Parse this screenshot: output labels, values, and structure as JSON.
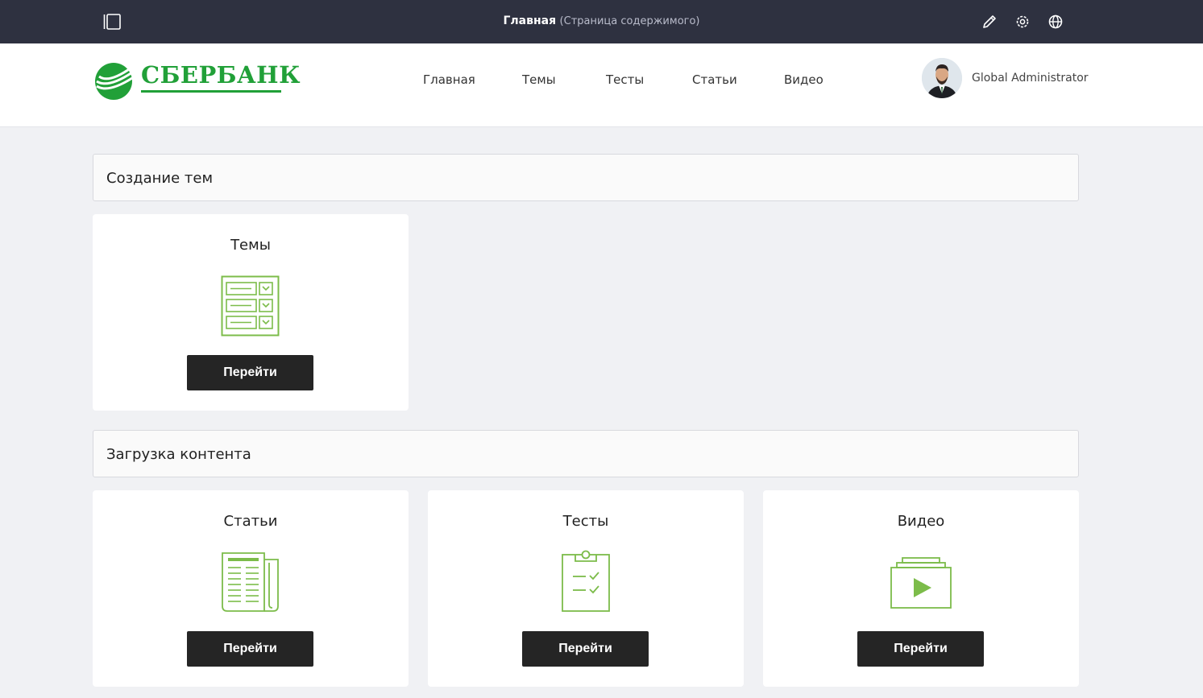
{
  "adminbar": {
    "title": "Главная",
    "subtitle": "(Страница содержимого)",
    "icons": [
      "sidebar-toggle-icon",
      "pencil-icon",
      "gear-icon",
      "globe-icon"
    ]
  },
  "header": {
    "logo_text": "СБЕРБАНК",
    "nav": [
      {
        "label": "Главная"
      },
      {
        "label": "Темы"
      },
      {
        "label": "Тесты"
      },
      {
        "label": "Статьи"
      },
      {
        "label": "Видео"
      }
    ],
    "user_name": "Global Administrator"
  },
  "sections": [
    {
      "title": "Создание тем",
      "cards": [
        {
          "title": "Темы",
          "icon": "topics-form-icon",
          "button": "Перейти"
        }
      ]
    },
    {
      "title": "Загрузка контента",
      "cards": [
        {
          "title": "Статьи",
          "icon": "articles-newspaper-icon",
          "button": "Перейти"
        },
        {
          "title": "Тесты",
          "icon": "tests-clipboard-icon",
          "button": "Перейти"
        },
        {
          "title": "Видео",
          "icon": "video-play-icon",
          "button": "Перейти"
        }
      ]
    }
  ],
  "colors": {
    "adminbar_bg": "#2e3140",
    "brand_green": "#21a038",
    "icon_green": "#7cbc4a",
    "button_bg": "#252525",
    "page_bg": "#f0f1f4"
  }
}
